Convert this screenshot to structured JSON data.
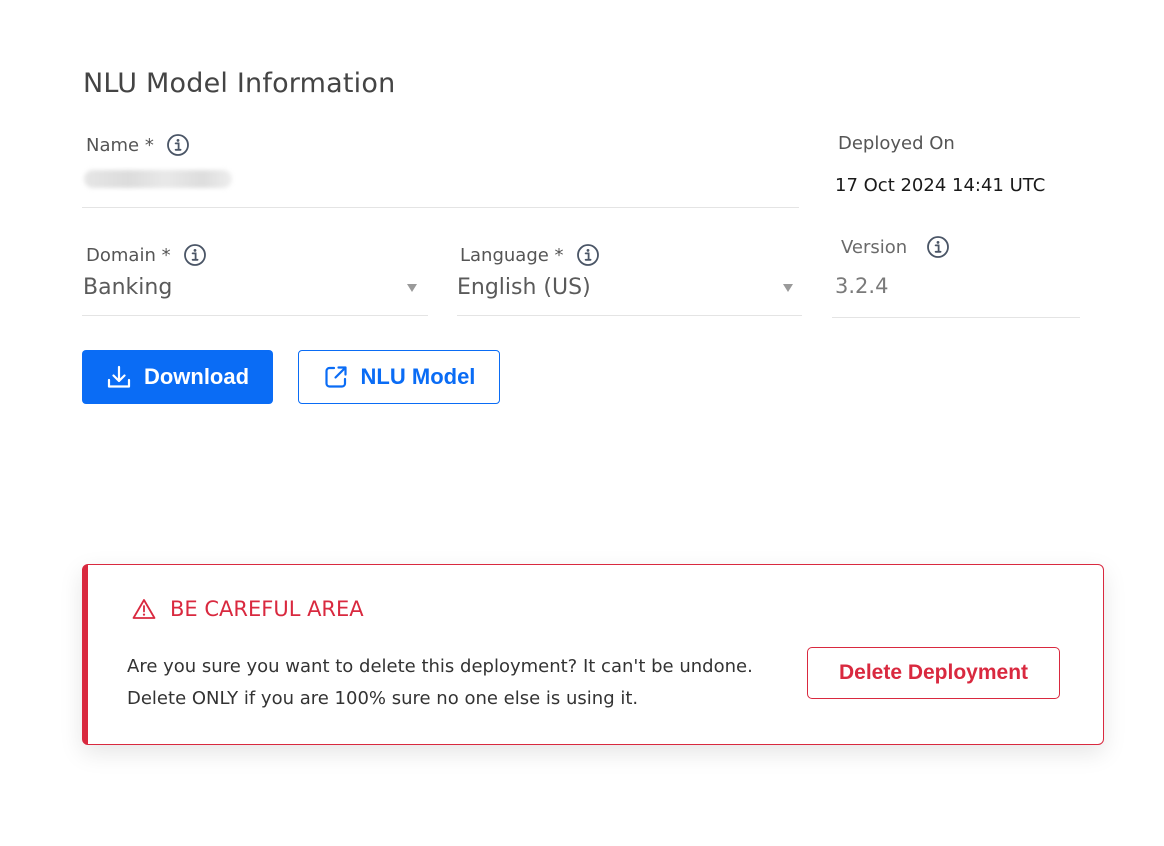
{
  "section": {
    "title": "NLU Model Information"
  },
  "fields": {
    "name": {
      "label": "Name *"
    },
    "deployed_on": {
      "label": "Deployed On",
      "value": "17 Oct 2024 14:41 UTC"
    },
    "domain": {
      "label": "Domain *",
      "value": "Banking"
    },
    "language": {
      "label": "Language *",
      "value": "English (US)"
    },
    "version": {
      "label": "Version",
      "value": "3.2.4"
    }
  },
  "buttons": {
    "download": "Download",
    "nlu_model": "NLU Model"
  },
  "danger_zone": {
    "title": "BE CAREFUL AREA",
    "message": "Are you sure you want to delete this deployment? It can't be undone. Delete ONLY if you are 100% sure no one else is using it.",
    "delete_label": "Delete Deployment"
  },
  "icons": {
    "info": "info-icon",
    "download": "download-icon",
    "external_link": "external-link-icon",
    "warning": "warning-icon",
    "caret": "caret-down-icon"
  },
  "colors": {
    "primary": "#0a6cf5",
    "danger": "#d9293f",
    "info_icon": "#4a5566"
  }
}
